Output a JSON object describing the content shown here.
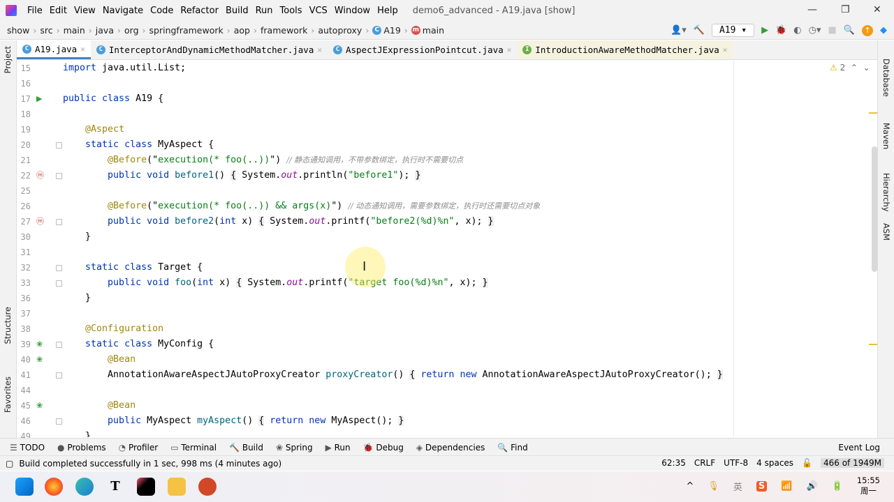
{
  "window": {
    "title": "demo6_advanced - A19.java [show]",
    "menus": [
      "File",
      "Edit",
      "View",
      "Navigate",
      "Code",
      "Refactor",
      "Build",
      "Run",
      "Tools",
      "VCS",
      "Window",
      "Help"
    ]
  },
  "breadcrumb": [
    "show",
    "src",
    "main",
    "java",
    "org",
    "springframework",
    "aop",
    "framework",
    "autoproxy",
    "A19",
    "main"
  ],
  "toolbar": {
    "run_config": "A19"
  },
  "tabs": [
    {
      "label": "A19.java",
      "icon": "class",
      "active": true
    },
    {
      "label": "InterceptorAndDynamicMethodMatcher.java",
      "icon": "class"
    },
    {
      "label": "AspectJExpressionPointcut.java",
      "icon": "class"
    },
    {
      "label": "IntroductionAwareMethodMatcher.java",
      "icon": "interface"
    }
  ],
  "left_tools": [
    "Project",
    "Structure",
    "Favorites"
  ],
  "right_tools": [
    "Database",
    "Maven",
    "Hierarchy",
    "ASM"
  ],
  "warnings": "2",
  "code": [
    {
      "n": "15",
      "t": [
        [
          "k",
          "import"
        ],
        [
          "p",
          " java.util.List;"
        ]
      ]
    },
    {
      "n": "16",
      "t": []
    },
    {
      "n": "17",
      "g": "run",
      "t": [
        [
          "k",
          "public class"
        ],
        [
          "p",
          " A19 {"
        ]
      ]
    },
    {
      "n": "18",
      "t": []
    },
    {
      "n": "19",
      "t": [
        [
          "p",
          "    "
        ],
        [
          "a",
          "@Aspect"
        ]
      ]
    },
    {
      "n": "20",
      "fold": 1,
      "t": [
        [
          "p",
          "    "
        ],
        [
          "k",
          "static class"
        ],
        [
          "p",
          " MyAspect {"
        ]
      ]
    },
    {
      "n": "21",
      "t": [
        [
          "p",
          "        "
        ],
        [
          "a",
          "@Before"
        ],
        [
          "p",
          "(\""
        ],
        [
          "s",
          "execution(* foo(..))"
        ],
        [
          "p",
          "\") "
        ],
        [
          "c",
          "// 静态通知调用，不带参数绑定，执行时不需要切点"
        ]
      ]
    },
    {
      "n": "22",
      "g": "method",
      "fold": 1,
      "t": [
        [
          "p",
          "        "
        ],
        [
          "k",
          "public void"
        ],
        [
          "p",
          " "
        ],
        [
          "m",
          "before1"
        ],
        [
          "p",
          "() "
        ],
        [
          "b",
          "{"
        ],
        [
          "p",
          " System."
        ],
        [
          "f",
          "out"
        ],
        [
          "p",
          ".println("
        ],
        [
          "s",
          "\"before1\""
        ],
        [
          "p",
          "); "
        ],
        [
          "b",
          "}"
        ]
      ]
    },
    {
      "n": "25",
      "t": []
    },
    {
      "n": "26",
      "t": [
        [
          "p",
          "        "
        ],
        [
          "a",
          "@Before"
        ],
        [
          "p",
          "(\""
        ],
        [
          "s",
          "execution(* foo(..)) && args(x)"
        ],
        [
          "p",
          "\") "
        ],
        [
          "c",
          "// 动态通知调用，需要参数绑定，执行时还需要切点对象"
        ]
      ]
    },
    {
      "n": "27",
      "g": "method",
      "fold": 1,
      "t": [
        [
          "p",
          "        "
        ],
        [
          "k",
          "public void"
        ],
        [
          "p",
          " "
        ],
        [
          "m",
          "before2"
        ],
        [
          "p",
          "("
        ],
        [
          "k",
          "int"
        ],
        [
          "p",
          " x) "
        ],
        [
          "b",
          "{"
        ],
        [
          "p",
          " System."
        ],
        [
          "f",
          "out"
        ],
        [
          "p",
          ".printf("
        ],
        [
          "s",
          "\"before2(%d)%n\""
        ],
        [
          "p",
          ", x); "
        ],
        [
          "b",
          "}"
        ]
      ]
    },
    {
      "n": "30",
      "t": [
        [
          "p",
          "    }"
        ]
      ]
    },
    {
      "n": "31",
      "t": []
    },
    {
      "n": "32",
      "fold": 1,
      "t": [
        [
          "p",
          "    "
        ],
        [
          "k",
          "static class"
        ],
        [
          "p",
          " Target {"
        ]
      ]
    },
    {
      "n": "33",
      "fold": 1,
      "t": [
        [
          "p",
          "        "
        ],
        [
          "k",
          "public void"
        ],
        [
          "p",
          " "
        ],
        [
          "m",
          "foo"
        ],
        [
          "p",
          "("
        ],
        [
          "k",
          "int"
        ],
        [
          "p",
          " x) "
        ],
        [
          "b",
          "{"
        ],
        [
          "p",
          " System."
        ],
        [
          "f",
          "out"
        ],
        [
          "p",
          ".printf("
        ],
        [
          "s",
          "\"target foo(%d)%n\""
        ],
        [
          "p",
          ", x); "
        ],
        [
          "b",
          "}"
        ]
      ]
    },
    {
      "n": "36",
      "t": [
        [
          "p",
          "    }"
        ]
      ]
    },
    {
      "n": "37",
      "t": []
    },
    {
      "n": "38",
      "t": [
        [
          "p",
          "    "
        ],
        [
          "a",
          "@Configuration"
        ]
      ]
    },
    {
      "n": "39",
      "g": "bean",
      "fold": 1,
      "t": [
        [
          "p",
          "    "
        ],
        [
          "k",
          "static class"
        ],
        [
          "p",
          " MyConfig {"
        ]
      ]
    },
    {
      "n": "40",
      "g": "bean",
      "t": [
        [
          "p",
          "        "
        ],
        [
          "a",
          "@Bean"
        ]
      ]
    },
    {
      "n": "41",
      "fold": 1,
      "t": [
        [
          "p",
          "        AnnotationAwareAspectJAutoProxyCreator "
        ],
        [
          "m",
          "proxyCreator"
        ],
        [
          "p",
          "() "
        ],
        [
          "b",
          "{"
        ],
        [
          "p",
          " "
        ],
        [
          "k",
          "return new"
        ],
        [
          "p",
          " AnnotationAwareAspectJAutoProxyCreator(); "
        ],
        [
          "b",
          "}"
        ]
      ]
    },
    {
      "n": "44",
      "t": []
    },
    {
      "n": "45",
      "g": "bean",
      "t": [
        [
          "p",
          "        "
        ],
        [
          "a",
          "@Bean"
        ]
      ]
    },
    {
      "n": "46",
      "fold": 1,
      "t": [
        [
          "p",
          "        "
        ],
        [
          "k",
          "public"
        ],
        [
          "p",
          " MyAspect "
        ],
        [
          "m",
          "myAspect"
        ],
        [
          "p",
          "() "
        ],
        [
          "b",
          "{"
        ],
        [
          "p",
          " "
        ],
        [
          "k",
          "return new"
        ],
        [
          "p",
          " MyAspect(); "
        ],
        [
          "b",
          "}"
        ]
      ]
    },
    {
      "n": "49",
      "t": [
        [
          "p",
          "    }"
        ]
      ]
    }
  ],
  "tool_windows": [
    "TODO",
    "Problems",
    "Profiler",
    "Terminal",
    "Build",
    "Spring",
    "Run",
    "Debug",
    "Dependencies",
    "Find"
  ],
  "event_log": "Event Log",
  "status": {
    "message": "Build completed successfully in 1 sec, 998 ms (4 minutes ago)",
    "position": "62:35",
    "line_sep": "CRLF",
    "encoding": "UTF-8",
    "indent": "4 spaces",
    "memory": "466 of 1949M"
  },
  "taskbar": {
    "time": "15:55",
    "day": "周一",
    "ime": "英"
  }
}
